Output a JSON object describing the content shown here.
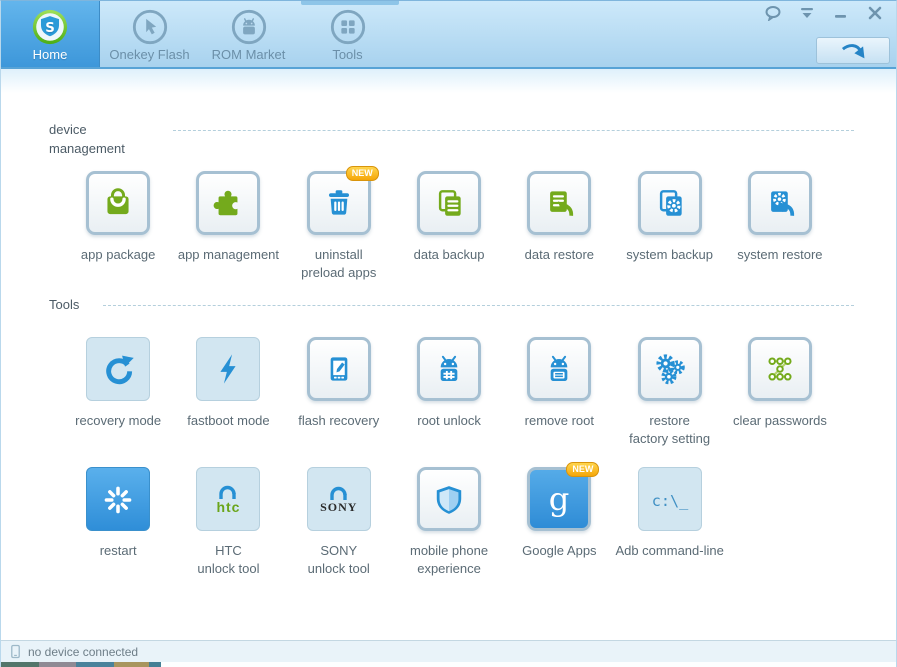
{
  "titlebar": {
    "controls": [
      {
        "icon": "feedback-icon"
      },
      {
        "icon": "skin-icon"
      },
      {
        "icon": "minimize-icon"
      },
      {
        "icon": "close-icon"
      }
    ]
  },
  "toolbar": {
    "tabs": [
      {
        "label": "Home",
        "icon": "shuame-logo-icon",
        "active": true
      },
      {
        "label": "Onekey Flash",
        "icon": "cursor-circle-icon",
        "active": false
      },
      {
        "label": "ROM Market",
        "icon": "android-circle-icon",
        "active": false
      },
      {
        "label": "Tools",
        "icon": "grid-circle-icon",
        "active": false
      }
    ],
    "action_button": {
      "icon": "curved-arrow-icon"
    }
  },
  "sections": [
    {
      "title": "device management",
      "rows": [
        [
          {
            "label": "app package",
            "icon": "shopping-bag-icon",
            "style": "bordered",
            "color": "green"
          },
          {
            "label": "app management",
            "icon": "puzzle-icon",
            "style": "bordered",
            "color": "green"
          },
          {
            "label": "uninstall\npreload apps",
            "icon": "trash-icon",
            "style": "bordered",
            "color": "blue",
            "badge": "NEW"
          },
          {
            "label": "data backup",
            "icon": "documents-icon",
            "style": "bordered",
            "color": "green"
          },
          {
            "label": "data restore",
            "icon": "document-restore-icon",
            "style": "bordered",
            "color": "green"
          },
          {
            "label": "system backup",
            "icon": "system-backup-icon",
            "style": "bordered",
            "color": "blue"
          },
          {
            "label": "system restore",
            "icon": "system-restore-icon",
            "style": "bordered",
            "color": "blue"
          }
        ]
      ]
    },
    {
      "title": "Tools",
      "rows": [
        [
          {
            "label": "recovery mode",
            "icon": "refresh-icon",
            "style": "flat",
            "color": "blue"
          },
          {
            "label": "fastboot mode",
            "icon": "lightning-icon",
            "style": "flat",
            "color": "blue"
          },
          {
            "label": "flash recovery",
            "icon": "phone-edit-icon",
            "style": "bordered",
            "color": "blue"
          },
          {
            "label": "root unlock",
            "icon": "android-hash-icon",
            "style": "bordered",
            "color": "blue"
          },
          {
            "label": "remove root",
            "icon": "android-lines-icon",
            "style": "bordered",
            "color": "blue"
          },
          {
            "label": "restore\nfactory setting",
            "icon": "gears-icon",
            "style": "bordered",
            "color": "blue"
          },
          {
            "label": "clear passwords",
            "icon": "pattern-lock-icon",
            "style": "bordered",
            "color": "green"
          }
        ],
        [
          {
            "label": "restart",
            "icon": "spinner-icon",
            "style": "solid",
            "color": "white"
          },
          {
            "label": "HTC\nunlock tool",
            "icon": "padlock-shackle-icon",
            "style": "flat",
            "color": "blue",
            "brand": "htc",
            "brand_style": "htc"
          },
          {
            "label": "SONY\nunlock tool",
            "icon": "padlock-shackle-icon",
            "style": "flat",
            "color": "blue",
            "brand": "SONY",
            "brand_style": "sony"
          },
          {
            "label": "mobile phone\nexperience",
            "icon": "shield-icon",
            "style": "bordered",
            "color": "blue"
          },
          {
            "label": "Google Apps",
            "icon": "google-g-icon",
            "style": "bordered-blue",
            "color": "white",
            "badge": "NEW"
          },
          {
            "label": "Adb command-line",
            "icon": "cmd-icon",
            "style": "flat",
            "color": "blue"
          }
        ]
      ]
    }
  ],
  "statusbar": {
    "icon": "phone-icon",
    "text": "no device connected"
  },
  "colors": {
    "accent_blue": "#2690d4",
    "icon_green": "#74aa1c",
    "badge_orange": "#f5a609",
    "active_tab_blue": "#459cde",
    "toolbar_blue": "#a8d2ee"
  }
}
